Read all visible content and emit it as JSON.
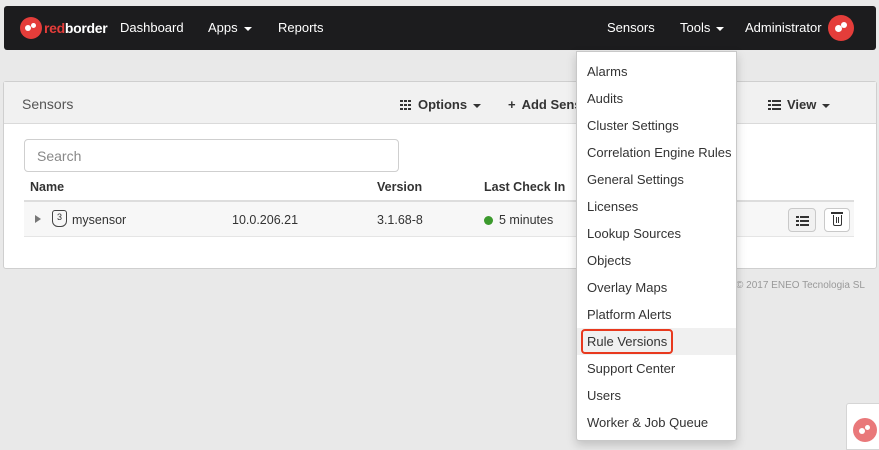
{
  "navbar": {
    "brand_red": "red",
    "brand_white": "border",
    "dashboard": "Dashboard",
    "apps": "Apps",
    "reports": "Reports",
    "sensors": "Sensors",
    "tools": "Tools",
    "user": "Administrator"
  },
  "panel": {
    "title": "Sensors",
    "options_label": "Options",
    "add_label": "Add Sens",
    "view_label": "View",
    "search_placeholder": "Search",
    "columns": {
      "name": "Name",
      "version": "Version",
      "last_check_in": "Last Check In"
    },
    "rows": [
      {
        "name": "mysensor",
        "badge": "3",
        "ip": "10.0.206.21",
        "version": "3.1.68-8",
        "last_check_in": "5 minutes",
        "status_color": "#3c9a2d"
      }
    ]
  },
  "footer": {
    "copyright": "© 2017 ENEO Tecnologia SL"
  },
  "tools_menu": {
    "items": [
      "Alarms",
      "Audits",
      "Cluster Settings",
      "Correlation Engine Rules",
      "General Settings",
      "Licenses",
      "Lookup Sources",
      "Objects",
      "Overlay Maps",
      "Platform Alerts",
      "Rule Versions",
      "Support Center",
      "Users",
      "Worker & Job Queue"
    ],
    "highlighted": "Rule Versions"
  },
  "colors": {
    "brand": "#e43d3a",
    "navbar_bg": "#1c1c1e",
    "highlight_border": "#e8391e"
  }
}
